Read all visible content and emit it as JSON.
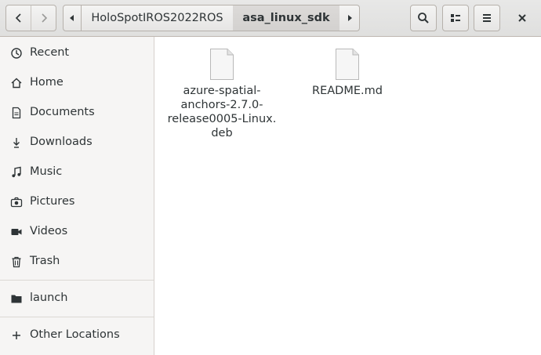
{
  "window": {
    "close_icon": "close-icon"
  },
  "toolbar": {
    "back_icon": "chevron-left-icon",
    "forward_icon": "chevron-right-icon",
    "search_icon": "search-icon",
    "view_icon": "view-list-icon",
    "menu_icon": "hamburger-menu-icon"
  },
  "pathbar": {
    "crumbs": [
      "HoloSpotIROS2022ROS",
      "asa_linux_sdk"
    ],
    "active_index": 1
  },
  "sidebar": {
    "places": [
      {
        "label": "Recent",
        "icon": "clock-icon"
      },
      {
        "label": "Home",
        "icon": "home-icon"
      },
      {
        "label": "Documents",
        "icon": "document-icon"
      },
      {
        "label": "Downloads",
        "icon": "download-icon"
      },
      {
        "label": "Music",
        "icon": "music-icon"
      },
      {
        "label": "Pictures",
        "icon": "camera-icon"
      },
      {
        "label": "Videos",
        "icon": "video-icon"
      },
      {
        "label": "Trash",
        "icon": "trash-icon"
      }
    ],
    "bookmarks": [
      {
        "label": "launch",
        "icon": "folder-icon"
      }
    ],
    "other": {
      "label": "Other Locations",
      "icon": "plus-icon"
    }
  },
  "files": [
    {
      "name_lines": [
        "azure-spatial-",
        "anchors-2.7.0-",
        "release0005-Linux.",
        "deb"
      ],
      "icon": "file-icon"
    },
    {
      "name_lines": [
        "README.md"
      ],
      "icon": "file-icon"
    }
  ],
  "colors": {
    "headerbar": "#e8e8e7",
    "sidebar": "#f6f5f4",
    "text": "#2e3436",
    "active_crumb": "#d8d6d4"
  }
}
